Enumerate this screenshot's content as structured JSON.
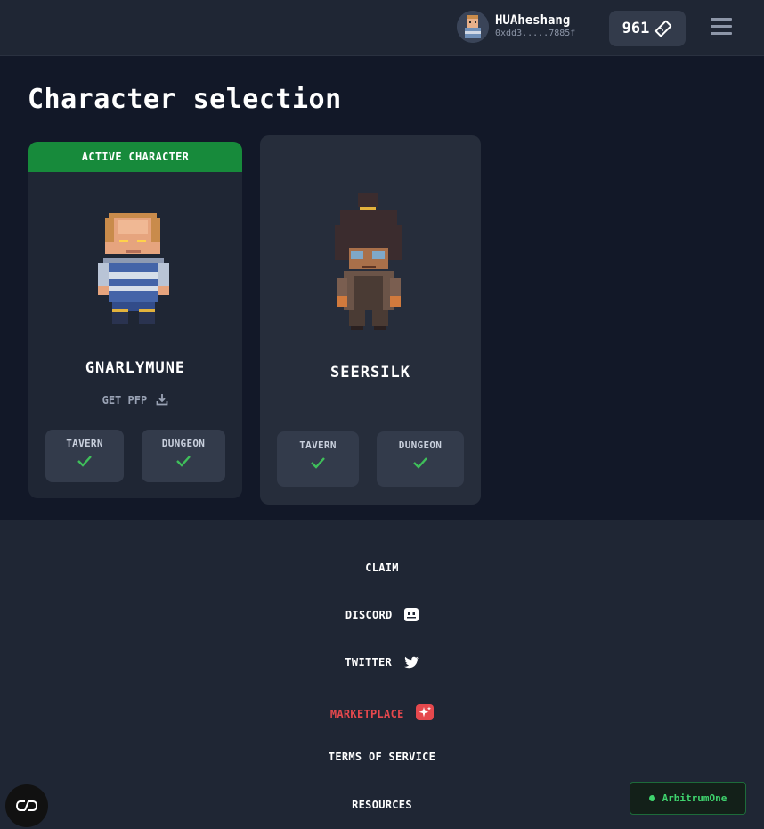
{
  "header": {
    "username": "HUAheshang",
    "address": "0xdd3.....7885f",
    "tickets_count": "961",
    "tickets_icon": "ticket-icon",
    "menu_icon": "hamburger-icon"
  },
  "page": {
    "title": "Character selection"
  },
  "characters": [
    {
      "active_label": "ACTIVE CHARACTER",
      "name": "GNARLYMUNE",
      "pfp_label": "GET PFP",
      "tavern_label": "TAVERN",
      "dungeon_label": "DUNGEON",
      "tavern_done": true,
      "dungeon_done": true
    },
    {
      "name": "SEERSILK",
      "tavern_label": "TAVERN",
      "dungeon_label": "DUNGEON",
      "tavern_done": true,
      "dungeon_done": true
    }
  ],
  "footer": {
    "links": [
      {
        "label": "CLAIM"
      },
      {
        "label": "DISCORD",
        "icon": "discord-icon"
      },
      {
        "label": "TWITTER",
        "icon": "twitter-icon"
      },
      {
        "label": "MARKETPLACE",
        "icon": "sparkles-icon"
      },
      {
        "label": "TERMS OF SERVICE"
      },
      {
        "label": "RESOURCES"
      }
    ]
  },
  "network": {
    "label": "ArbitrumOne",
    "status_color": "#3fd36e"
  },
  "colors": {
    "accent_green": "#178a3b",
    "check_green": "#3fbf5a",
    "marketplace_red": "#e5484d",
    "background": "#121828",
    "panel": "#1f2634"
  }
}
